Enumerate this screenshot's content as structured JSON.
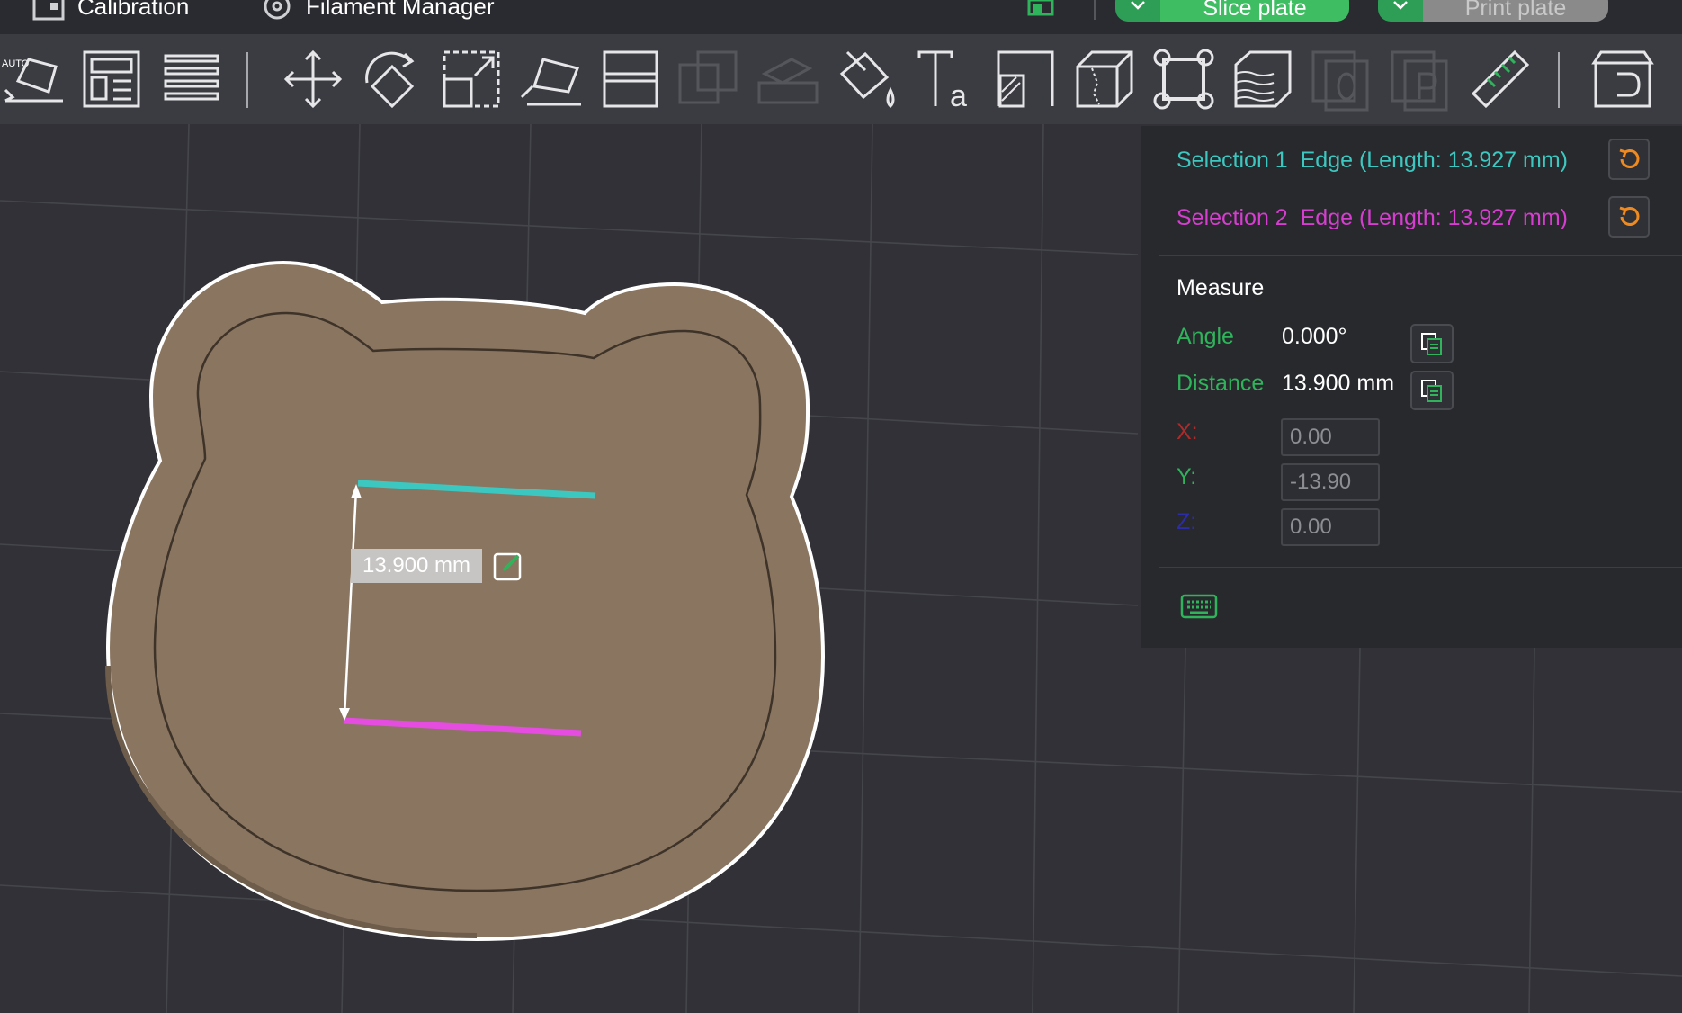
{
  "topbar": {
    "calibration_label": "Calibration",
    "filament_label": "Filament Manager",
    "slice_label": "Slice plate",
    "print_label": "Print plate"
  },
  "toolbar": {
    "auto_badge": "AUTO",
    "tools": [
      "auto-orient",
      "arrange",
      "layers",
      "move",
      "rotate",
      "scale",
      "lay-on-face",
      "cut",
      "boolean",
      "supports",
      "paint",
      "text",
      "emboss",
      "brim",
      "seam",
      "fuzzy",
      "variable-layer",
      "assembly-o",
      "assembly-p",
      "measure",
      "assemble"
    ],
    "disabled_tools": [
      "boolean",
      "supports",
      "assembly-o",
      "assembly-p"
    ]
  },
  "measure_panel": {
    "selection1": {
      "prefix": "Selection 1",
      "desc": "Edge (Length: 13.927 mm)",
      "color": "#3cc8c0"
    },
    "selection2": {
      "prefix": "Selection 2",
      "desc": "Edge (Length: 13.927 mm)",
      "color": "#d63ed0"
    },
    "section_title": "Measure",
    "angle_label": "Angle",
    "angle_value": "0.000°",
    "distance_label": "Distance",
    "distance_value": "13.900 mm",
    "x_label": "X:",
    "y_label": "Y:",
    "z_label": "Z:",
    "x_value": "0.00",
    "y_value": "-13.90",
    "z_value": "0.00",
    "accent_green": "#2fb35b"
  },
  "viewport": {
    "dimension_label": "13.900 mm",
    "model_color": "#8a7560",
    "edge1_color": "#3cc8c0",
    "edge2_color": "#e44de0"
  }
}
